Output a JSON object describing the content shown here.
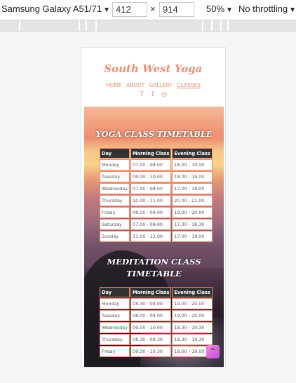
{
  "devtools": {
    "device": "Samsung Galaxy A51/71",
    "width": "412",
    "times": "×",
    "height": "914",
    "zoom": "50%",
    "throttling": "No throttling",
    "caret": "▼"
  },
  "site": {
    "brand": "South West Yoga",
    "nav": [
      "HOME",
      "ABOUT",
      "GALLERY",
      "CLASSES"
    ],
    "social": [
      "twitter-icon",
      "facebook-icon",
      "instagram-icon"
    ]
  },
  "yoga": {
    "title": "YOGA CLASS TIMETABLE",
    "headers": [
      "Day",
      "Morning Class",
      "Evening Class"
    ],
    "rows": [
      [
        "Monday",
        "07.00 - 08.00",
        "18.00 - 19.00"
      ],
      [
        "Tuesday",
        "09.00 - 10.00",
        "18.00 - 19.00"
      ],
      [
        "Wednesday",
        "07.00 - 08.00",
        "17.00 - 18.00"
      ],
      [
        "Thursday",
        "10.00 - 11.00",
        "20.00 - 21.00"
      ],
      [
        "Friday",
        "08.00 - 09.00",
        "19.00 - 20.00"
      ],
      [
        "Saturday",
        "07.00 - 08.00",
        "17.30 - 18.30"
      ],
      [
        "Sunday",
        "11.00 - 12.00",
        "17.00 - 18.00"
      ]
    ]
  },
  "meditation": {
    "title_line1": "MEDITATION CLASS",
    "title_line2": "TIMETABLE",
    "headers": [
      "Day",
      "Morning Class",
      "Evening Class"
    ],
    "rows": [
      [
        "Monday",
        "08.30 - 09.00",
        "19.00 - 20.00"
      ],
      [
        "Tuesday",
        "08.00 - 09.00",
        "19.00 - 20.00"
      ],
      [
        "Wednesday",
        "09.00 - 10.00",
        "18.30 - 19.30"
      ],
      [
        "Thursday",
        "08.30 - 09.30",
        "18.30 - 19.30"
      ],
      [
        "Friday",
        "09.30 - 10.30",
        "18.00 - 19.00"
      ]
    ]
  },
  "scroll_top": "^"
}
